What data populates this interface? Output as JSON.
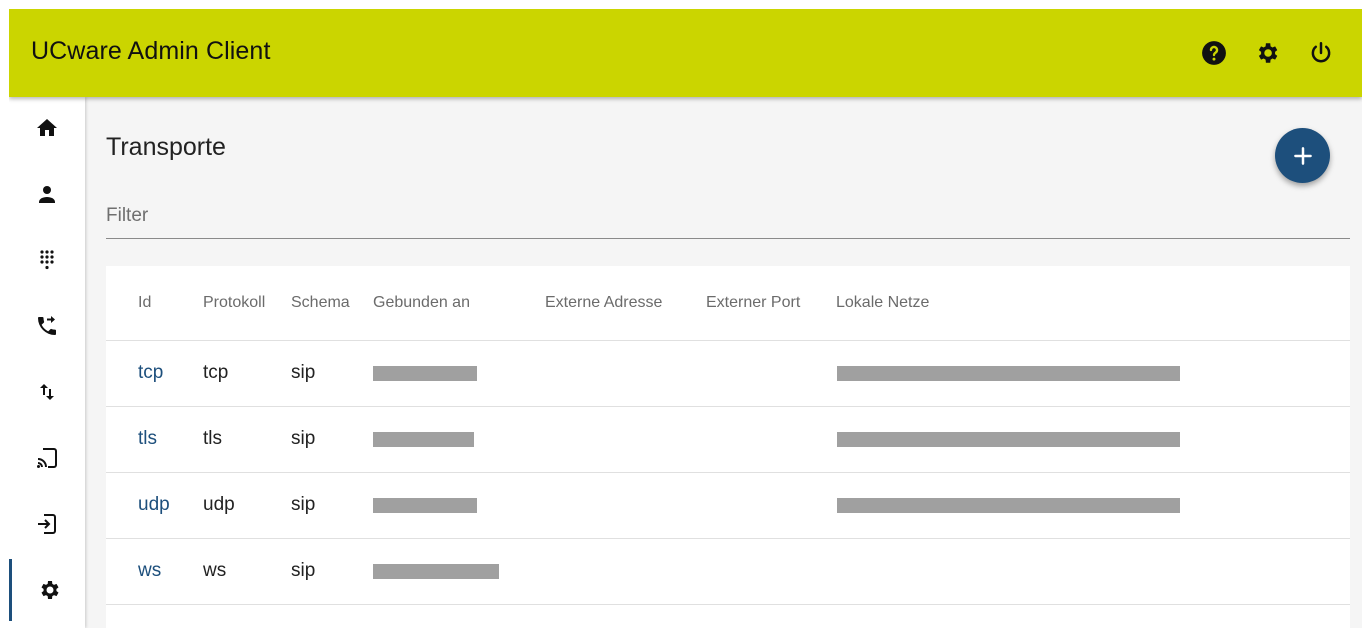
{
  "app": {
    "title": "UCware Admin Client"
  },
  "header_icons": [
    "help-icon",
    "settings-gear-icon",
    "power-icon"
  ],
  "sidebar": {
    "items": [
      {
        "name": "home",
        "icon": "home-icon"
      },
      {
        "name": "users",
        "icon": "person-icon"
      },
      {
        "name": "dialpad",
        "icon": "dialpad-icon"
      },
      {
        "name": "call-forward",
        "icon": "call-forward-icon"
      },
      {
        "name": "swap",
        "icon": "swap-vert-icon"
      },
      {
        "name": "cast",
        "icon": "cast-icon"
      },
      {
        "name": "login",
        "icon": "login-icon"
      },
      {
        "name": "settings",
        "icon": "settings-gear-icon",
        "active": true
      }
    ]
  },
  "page": {
    "title": "Transporte"
  },
  "filter": {
    "placeholder": "Filter",
    "value": ""
  },
  "table": {
    "columns": [
      "Id",
      "Protokoll",
      "Schema",
      "Gebunden an",
      "Externe Adresse",
      "Externer Port",
      "Lokale Netze"
    ],
    "rows": [
      {
        "id": "tcp",
        "protokoll": "tcp",
        "schema": "sip",
        "gebunden_an": "[redacted]",
        "externe_adresse": "",
        "externer_port": "",
        "lokale_netze": "[redacted]"
      },
      {
        "id": "tls",
        "protokoll": "tls",
        "schema": "sip",
        "gebunden_an": "[redacted]",
        "externe_adresse": "",
        "externer_port": "",
        "lokale_netze": "[redacted]"
      },
      {
        "id": "udp",
        "protokoll": "udp",
        "schema": "sip",
        "gebunden_an": "[redacted]",
        "externe_adresse": "",
        "externer_port": "",
        "lokale_netze": "[redacted]"
      },
      {
        "id": "ws",
        "protokoll": "ws",
        "schema": "sip",
        "gebunden_an": "[redacted]",
        "externe_adresse": "",
        "externer_port": "",
        "lokale_netze": ""
      }
    ]
  },
  "colors": {
    "header_bg": "#cbd500",
    "accent": "#1d4f7c",
    "link": "#1d4f7c"
  }
}
